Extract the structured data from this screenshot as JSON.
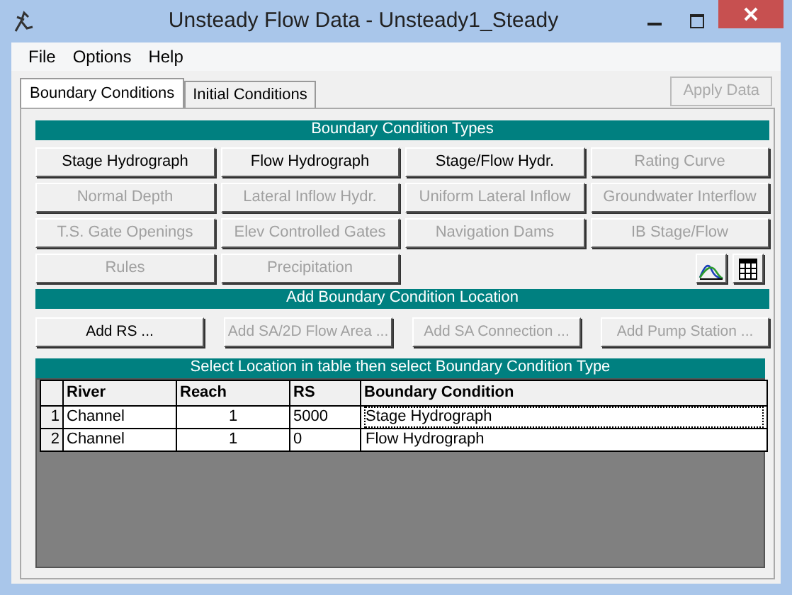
{
  "window": {
    "title": "Unsteady Flow Data - Unsteady1_Steady"
  },
  "menu": [
    "File",
    "Options",
    "Help"
  ],
  "tabs": [
    {
      "label": "Boundary Conditions",
      "selected": true
    },
    {
      "label": "Initial Conditions",
      "selected": false
    }
  ],
  "apply_button": {
    "label": "Apply Data",
    "disabled": true
  },
  "types": {
    "title": "Boundary Condition Types",
    "buttons": [
      {
        "label": "Stage Hydrograph",
        "disabled": false
      },
      {
        "label": "Flow Hydrograph",
        "disabled": false
      },
      {
        "label": "Stage/Flow Hydr.",
        "disabled": false
      },
      {
        "label": "Rating Curve",
        "disabled": true
      },
      {
        "label": "Normal Depth",
        "disabled": true
      },
      {
        "label": "Lateral Inflow Hydr.",
        "disabled": true
      },
      {
        "label": "Uniform Lateral Inflow",
        "disabled": true
      },
      {
        "label": "Groundwater Interflow",
        "disabled": true
      },
      {
        "label": "T.S. Gate Openings",
        "disabled": true
      },
      {
        "label": "Elev Controlled Gates",
        "disabled": true
      },
      {
        "label": "Navigation Dams",
        "disabled": true
      },
      {
        "label": "IB Stage/Flow",
        "disabled": true
      },
      {
        "label": "Rules",
        "disabled": true
      },
      {
        "label": "Precipitation",
        "disabled": true
      }
    ]
  },
  "location": {
    "title": "Add Boundary Condition Location",
    "buttons": [
      {
        "label": "Add RS ...",
        "disabled": false
      },
      {
        "label": "Add SA/2D Flow Area ...",
        "disabled": true
      },
      {
        "label": "Add SA Connection ...",
        "disabled": true
      },
      {
        "label": "Add Pump Station ...",
        "disabled": true
      }
    ]
  },
  "table": {
    "title": "Select Location in table then select Boundary Condition Type",
    "columns": [
      "River",
      "Reach",
      "RS",
      "Boundary Condition"
    ],
    "rows": [
      {
        "number": "1",
        "river": "Channel",
        "reach": "1",
        "rs": "5000",
        "boundary_condition": "Stage Hydrograph",
        "selected": true
      },
      {
        "number": "2",
        "river": "Channel",
        "reach": "1",
        "rs": "0",
        "boundary_condition": "Flow Hydrograph",
        "selected": false
      }
    ]
  }
}
